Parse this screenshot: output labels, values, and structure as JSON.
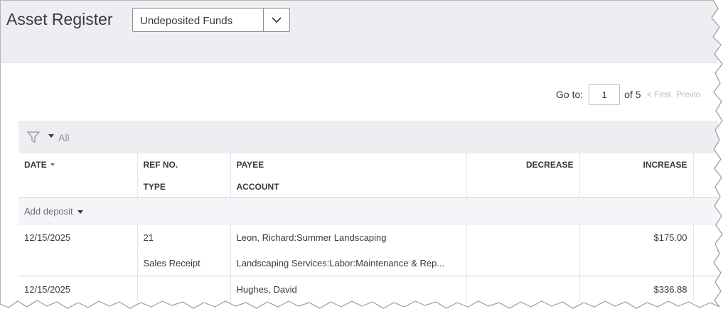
{
  "header": {
    "title": "Asset Register",
    "account_select": {
      "value": "Undeposited Funds"
    }
  },
  "pager": {
    "goto_label": "Go to:",
    "page_value": "1",
    "of_label": "of 5",
    "first_label": "< First",
    "previous_label": "Previo"
  },
  "filter": {
    "label": "All"
  },
  "table": {
    "columns": {
      "date": "DATE",
      "ref_no": "REF NO.",
      "type": "TYPE",
      "payee": "PAYEE",
      "account": "ACCOUNT",
      "decrease": "DECREASE",
      "increase": "INCREASE"
    },
    "add_deposit_label": "Add deposit",
    "rows": [
      {
        "date": "12/15/2025",
        "ref_no": "21",
        "payee": "Leon, Richard:Summer Landscaping",
        "decrease": "",
        "increase": "$175.00",
        "type": "Sales Receipt",
        "account": "Landscaping Services:Labor:Maintenance & Rep..."
      },
      {
        "date": "12/15/2025",
        "ref_no": "",
        "payee": "Hughes, David",
        "decrease": "",
        "increase": "$336.88"
      }
    ]
  },
  "colors": {
    "header_bg": "#eceef1",
    "text": "#393a3d",
    "muted": "#babec5",
    "add_row_bg": "#f4f5f8"
  }
}
